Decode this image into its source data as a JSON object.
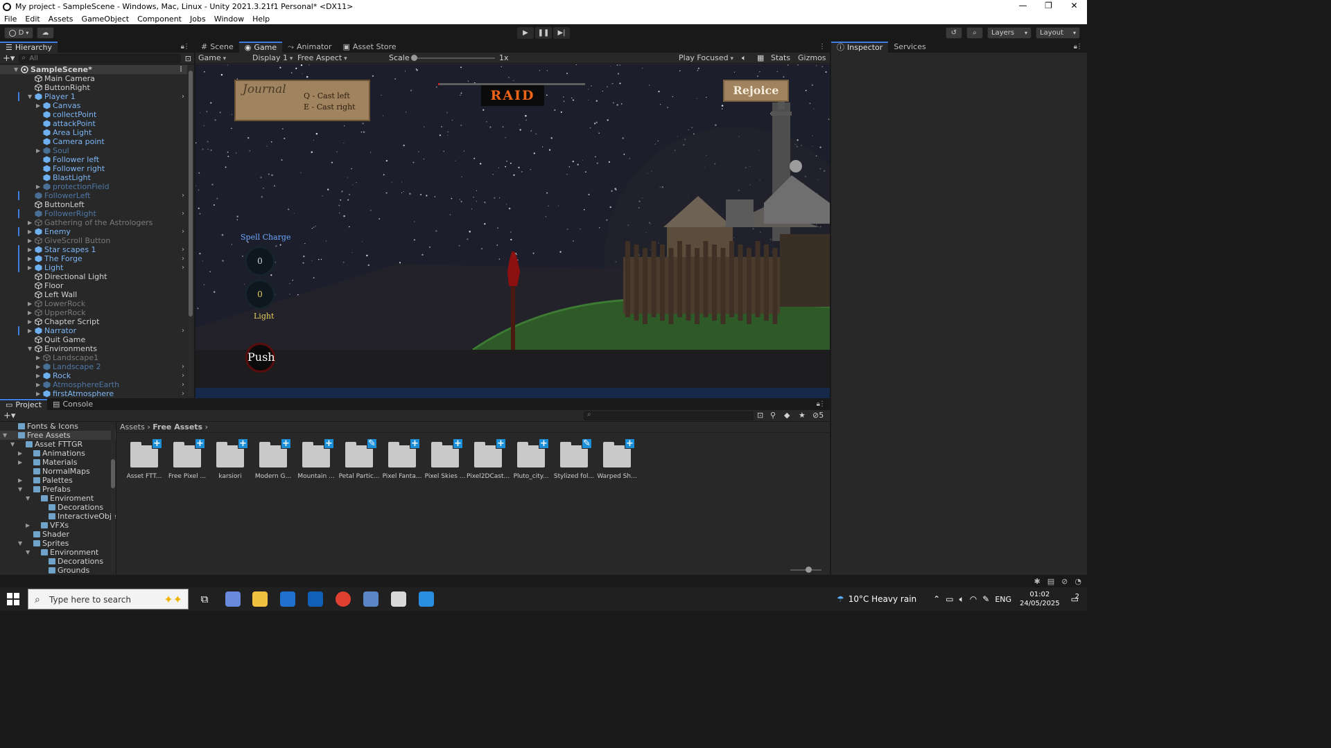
{
  "window": {
    "title": "My project - SampleScene - Windows, Mac, Linux - Unity 2021.3.21f1 Personal* <DX11>"
  },
  "menu": [
    "File",
    "Edit",
    "Assets",
    "GameObject",
    "Component",
    "Jobs",
    "Window",
    "Help"
  ],
  "toolbar": {
    "account": "D",
    "layers": "Layers",
    "layout": "Layout"
  },
  "hierarchy": {
    "tab": "Hierarchy",
    "search_placeholder": "All",
    "items": [
      {
        "label": "SampleScene*",
        "depth": 0,
        "kind": "scene",
        "expanded": true
      },
      {
        "label": "Main Camera",
        "depth": 1,
        "kind": "normal"
      },
      {
        "label": "ButtonRight",
        "depth": 1,
        "kind": "normal"
      },
      {
        "label": "Player 1",
        "depth": 1,
        "kind": "prefab",
        "expanded": true,
        "chevron": true
      },
      {
        "label": "Canvas",
        "depth": 2,
        "kind": "prefab",
        "collapsed": true
      },
      {
        "label": "collectPoint",
        "depth": 2,
        "kind": "prefab"
      },
      {
        "label": "attackPoint",
        "depth": 2,
        "kind": "prefab"
      },
      {
        "label": "Area Light",
        "depth": 2,
        "kind": "prefab"
      },
      {
        "label": "Camera point",
        "depth": 2,
        "kind": "prefab"
      },
      {
        "label": "Soul",
        "depth": 2,
        "kind": "prefab-disabled",
        "collapsed": true
      },
      {
        "label": "Follower left",
        "depth": 2,
        "kind": "prefab"
      },
      {
        "label": "Follower right",
        "depth": 2,
        "kind": "prefab"
      },
      {
        "label": "BlastLight",
        "depth": 2,
        "kind": "prefab"
      },
      {
        "label": "protectionField",
        "depth": 2,
        "kind": "prefab-disabled",
        "collapsed": true
      },
      {
        "label": "FollowerLeft",
        "depth": 1,
        "kind": "prefab-disabled",
        "chevron": true
      },
      {
        "label": "ButtonLeft",
        "depth": 1,
        "kind": "normal"
      },
      {
        "label": "FollowerRight",
        "depth": 1,
        "kind": "prefab-disabled",
        "chevron": true
      },
      {
        "label": "Gathering of the Astrologers",
        "depth": 1,
        "kind": "disabled",
        "collapsed": true
      },
      {
        "label": "Enemy",
        "depth": 1,
        "kind": "prefab",
        "collapsed": true,
        "chevron": true
      },
      {
        "label": "GiveScroll Button",
        "depth": 1,
        "kind": "disabled",
        "collapsed": true
      },
      {
        "label": "Star scapes 1",
        "depth": 1,
        "kind": "prefab",
        "collapsed": true,
        "chevron": true
      },
      {
        "label": "The Forge",
        "depth": 1,
        "kind": "prefab",
        "collapsed": true,
        "chevron": true
      },
      {
        "label": "Light",
        "depth": 1,
        "kind": "prefab",
        "collapsed": true,
        "chevron": true
      },
      {
        "label": "Directional Light",
        "depth": 1,
        "kind": "normal"
      },
      {
        "label": "Floor",
        "depth": 1,
        "kind": "normal"
      },
      {
        "label": "Left Wall",
        "depth": 1,
        "kind": "normal"
      },
      {
        "label": "LowerRock",
        "depth": 1,
        "kind": "disabled",
        "collapsed": true
      },
      {
        "label": "UpperRock",
        "depth": 1,
        "kind": "disabled",
        "collapsed": true
      },
      {
        "label": "Chapter Script",
        "depth": 1,
        "kind": "normal",
        "collapsed": true
      },
      {
        "label": "Narrator",
        "depth": 1,
        "kind": "prefab",
        "collapsed": true,
        "chevron": true
      },
      {
        "label": "Quit Game",
        "depth": 1,
        "kind": "normal"
      },
      {
        "label": "Environments",
        "depth": 1,
        "kind": "normal",
        "expanded": true
      },
      {
        "label": "Landscape1",
        "depth": 2,
        "kind": "disabled",
        "collapsed": true
      },
      {
        "label": "Landscape 2",
        "depth": 2,
        "kind": "prefab-disabled",
        "collapsed": true,
        "chevron": true
      },
      {
        "label": "Rock",
        "depth": 2,
        "kind": "prefab",
        "collapsed": true,
        "chevron": true
      },
      {
        "label": "AtmosphereEarth",
        "depth": 2,
        "kind": "prefab-disabled",
        "collapsed": true,
        "chevron": true
      },
      {
        "label": "firstAtmosphere",
        "depth": 2,
        "kind": "prefab",
        "collapsed": true,
        "chevron": true
      }
    ]
  },
  "center_tabs": [
    {
      "label": "Scene",
      "icon": "grid-icon"
    },
    {
      "label": "Game",
      "icon": "gamepad-icon",
      "active": true
    },
    {
      "label": "Animator",
      "icon": "animator-icon"
    },
    {
      "label": "Asset Store",
      "icon": "bag-icon"
    }
  ],
  "game_bar": {
    "mode": "Game",
    "display": "Display 1",
    "aspect": "Free Aspect",
    "scale_label": "Scale",
    "scale_value": "1x",
    "play_focused": "Play Focused",
    "stats": "Stats",
    "gizmos": "Gizmos"
  },
  "game": {
    "journal_title": "Journal",
    "journal_line1": "Q - Cast left",
    "journal_line2": "E - Cast right",
    "raid_title": "RAID",
    "raid_progress": 0.01,
    "rejoice": "Rejoice",
    "spell_charge_label": "Spell Charge",
    "spell_charge_value": "0",
    "light_value": "0",
    "light_label": "Light",
    "push_label": "Push"
  },
  "right_tabs": [
    {
      "label": "Inspector",
      "active": true
    },
    {
      "label": "Services"
    }
  ],
  "bottom_tabs": [
    {
      "label": "Project",
      "active": true
    },
    {
      "label": "Console"
    }
  ],
  "project": {
    "hidden_count": "5",
    "tree": [
      {
        "label": "Fonts & Icons",
        "depth": 1
      },
      {
        "label": "Free Assets",
        "depth": 1,
        "expanded": true,
        "selected": true
      },
      {
        "label": "Asset FTTGR",
        "depth": 2,
        "expanded": true
      },
      {
        "label": "Animations",
        "depth": 3,
        "collapsed": true
      },
      {
        "label": "Materials",
        "depth": 3,
        "collapsed": true
      },
      {
        "label": "NormalMaps",
        "depth": 3
      },
      {
        "label": "Palettes",
        "depth": 3,
        "collapsed": true
      },
      {
        "label": "Prefabs",
        "depth": 3,
        "expanded": true
      },
      {
        "label": "Enviroment",
        "depth": 4,
        "expanded": true
      },
      {
        "label": "Decorations",
        "depth": 5
      },
      {
        "label": "InteractiveObjects",
        "depth": 5
      },
      {
        "label": "VFXs",
        "depth": 4,
        "collapsed": true
      },
      {
        "label": "Shader",
        "depth": 3
      },
      {
        "label": "Sprites",
        "depth": 3,
        "expanded": true
      },
      {
        "label": "Environment",
        "depth": 4,
        "expanded": true
      },
      {
        "label": "Decorations",
        "depth": 5
      },
      {
        "label": "Grounds",
        "depth": 5
      }
    ],
    "breadcrumb": [
      "Assets",
      "Free Assets"
    ],
    "folders": [
      {
        "name": "Asset FTT...",
        "badge": "+"
      },
      {
        "name": "Free Pixel ...",
        "badge": "+"
      },
      {
        "name": "karsiori",
        "badge": "+"
      },
      {
        "name": "Modern G...",
        "badge": "+"
      },
      {
        "name": "Mountain ...",
        "badge": "+"
      },
      {
        "name": "Petal Partic...",
        "badge": "✎"
      },
      {
        "name": "Pixel Fanta...",
        "badge": "+"
      },
      {
        "name": "Pixel Skies ...",
        "badge": "+"
      },
      {
        "name": "Pixel2DCast...",
        "badge": "+"
      },
      {
        "name": "Pluto_city...",
        "badge": "+"
      },
      {
        "name": "Stylized fol...",
        "badge": "✎"
      },
      {
        "name": "Warped Sh...",
        "badge": "+"
      }
    ]
  },
  "taskbar": {
    "search_placeholder": "Type here to search",
    "weather": "10°C  Heavy rain",
    "language": "ENG",
    "time": "01:02",
    "date": "24/05/2025",
    "notifications": "2"
  },
  "colors": {
    "accent": "#3d7ee0",
    "prefab_text": "#7db6f5",
    "raid_text": "#f06418",
    "parchment": "#a08460"
  }
}
